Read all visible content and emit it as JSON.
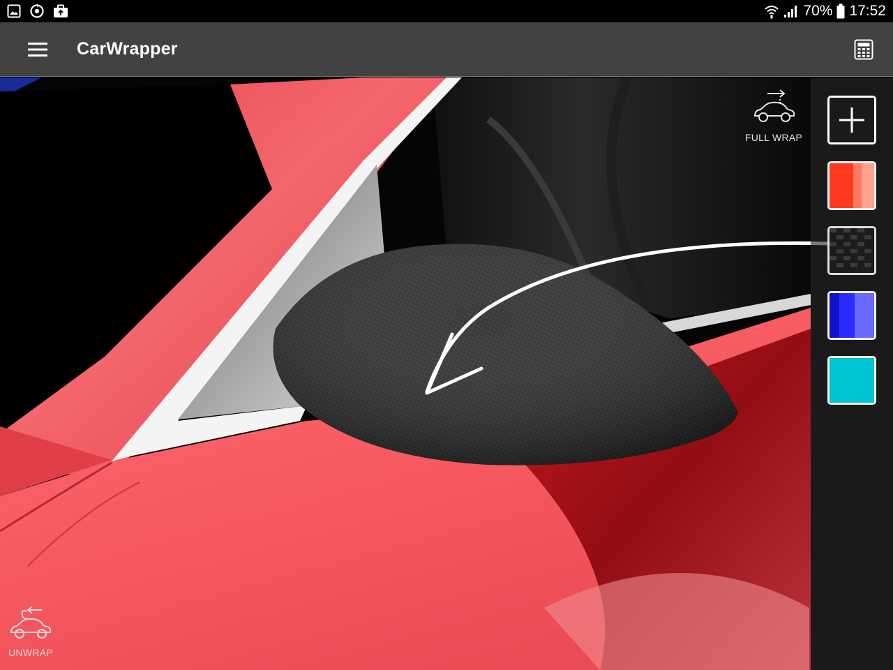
{
  "status_bar": {
    "battery_percent": "70%",
    "time": "17:52",
    "icons": [
      "gallery-icon",
      "sync-icon",
      "briefcase-icon",
      "wifi-icon",
      "signal-icon",
      "battery-icon"
    ]
  },
  "app_bar": {
    "title": "CarWrapper",
    "menu_icon": "hamburger-menu-icon",
    "action_icon": "calculator-icon"
  },
  "tools": {
    "full_wrap_label": "FULL WRAP",
    "unwrap_label": "UNWRAP"
  },
  "swatches": [
    {
      "name": "add",
      "icon": "plus-icon"
    },
    {
      "name": "red",
      "color": "#ff3a1f"
    },
    {
      "name": "carbon-fiber",
      "color": "#2a2a2a"
    },
    {
      "name": "blue",
      "color": "#2b2bff"
    },
    {
      "name": "cyan",
      "color": "#00c4d4"
    }
  ],
  "colors": {
    "app_bar": "#424242",
    "car_body": "#f0555e",
    "mirror": "#262626"
  }
}
